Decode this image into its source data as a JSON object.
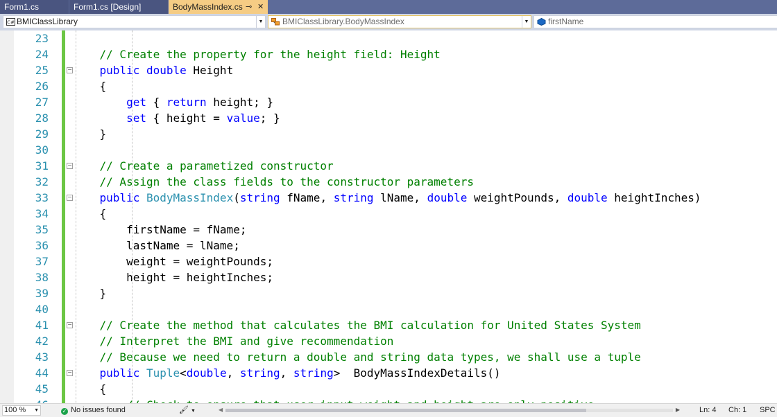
{
  "tabs": [
    {
      "label": "Form1.cs"
    },
    {
      "label": "Form1.cs [Design]"
    },
    {
      "label": "BodyMassIndex.cs",
      "pin": "⊸",
      "close": "✕"
    }
  ],
  "nav": {
    "project": "BMIClassLibrary",
    "type": "BMIClassLibrary.BodyMassIndex",
    "member": "firstName"
  },
  "lines": [
    {
      "n": "23",
      "parts": []
    },
    {
      "n": "24",
      "parts": [
        {
          "t": "c",
          "v": "    // Create the property for the height field: Height"
        }
      ]
    },
    {
      "n": "25",
      "fold": true,
      "parts": [
        {
          "t": "p",
          "v": "    "
        },
        {
          "t": "k",
          "v": "public"
        },
        {
          "t": "p",
          "v": " "
        },
        {
          "t": "k",
          "v": "double"
        },
        {
          "t": "p",
          "v": " Height"
        }
      ]
    },
    {
      "n": "26",
      "parts": [
        {
          "t": "p",
          "v": "    {"
        }
      ]
    },
    {
      "n": "27",
      "parts": [
        {
          "t": "p",
          "v": "        "
        },
        {
          "t": "k",
          "v": "get"
        },
        {
          "t": "p",
          "v": " { "
        },
        {
          "t": "k",
          "v": "return"
        },
        {
          "t": "p",
          "v": " height; }"
        }
      ]
    },
    {
      "n": "28",
      "parts": [
        {
          "t": "p",
          "v": "        "
        },
        {
          "t": "k",
          "v": "set"
        },
        {
          "t": "p",
          "v": " { height = "
        },
        {
          "t": "k",
          "v": "value"
        },
        {
          "t": "p",
          "v": "; }"
        }
      ]
    },
    {
      "n": "29",
      "parts": [
        {
          "t": "p",
          "v": "    }"
        }
      ]
    },
    {
      "n": "30",
      "parts": []
    },
    {
      "n": "31",
      "fold": true,
      "parts": [
        {
          "t": "c",
          "v": "    // Create a parametized constructor"
        }
      ]
    },
    {
      "n": "32",
      "parts": [
        {
          "t": "c",
          "v": "    // Assign the class fields to the constructor parameters"
        }
      ]
    },
    {
      "n": "33",
      "fold": true,
      "parts": [
        {
          "t": "p",
          "v": "    "
        },
        {
          "t": "k",
          "v": "public"
        },
        {
          "t": "p",
          "v": " "
        },
        {
          "t": "y",
          "v": "BodyMassIndex"
        },
        {
          "t": "p",
          "v": "("
        },
        {
          "t": "k",
          "v": "string"
        },
        {
          "t": "p",
          "v": " fName, "
        },
        {
          "t": "k",
          "v": "string"
        },
        {
          "t": "p",
          "v": " lName, "
        },
        {
          "t": "k",
          "v": "double"
        },
        {
          "t": "p",
          "v": " weightPounds, "
        },
        {
          "t": "k",
          "v": "double"
        },
        {
          "t": "p",
          "v": " heightInches)"
        }
      ]
    },
    {
      "n": "34",
      "parts": [
        {
          "t": "p",
          "v": "    {"
        }
      ]
    },
    {
      "n": "35",
      "parts": [
        {
          "t": "p",
          "v": "        firstName = fName;"
        }
      ]
    },
    {
      "n": "36",
      "parts": [
        {
          "t": "p",
          "v": "        lastName = lName;"
        }
      ]
    },
    {
      "n": "37",
      "parts": [
        {
          "t": "p",
          "v": "        weight = weightPounds;"
        }
      ]
    },
    {
      "n": "38",
      "parts": [
        {
          "t": "p",
          "v": "        height = heightInches;"
        }
      ]
    },
    {
      "n": "39",
      "parts": [
        {
          "t": "p",
          "v": "    }"
        }
      ]
    },
    {
      "n": "40",
      "parts": []
    },
    {
      "n": "41",
      "fold": true,
      "parts": [
        {
          "t": "c",
          "v": "    // Create the method that calculates the BMI calculation for United States System"
        }
      ]
    },
    {
      "n": "42",
      "parts": [
        {
          "t": "c",
          "v": "    // Interpret the BMI and give recommendation"
        }
      ]
    },
    {
      "n": "43",
      "parts": [
        {
          "t": "c",
          "v": "    // Because we need to return a double and string data types, we shall use a tuple"
        }
      ]
    },
    {
      "n": "44",
      "fold": true,
      "parts": [
        {
          "t": "p",
          "v": "    "
        },
        {
          "t": "k",
          "v": "public"
        },
        {
          "t": "p",
          "v": " "
        },
        {
          "t": "y",
          "v": "Tuple"
        },
        {
          "t": "p",
          "v": "<"
        },
        {
          "t": "k",
          "v": "double"
        },
        {
          "t": "p",
          "v": ", "
        },
        {
          "t": "k",
          "v": "string"
        },
        {
          "t": "p",
          "v": ", "
        },
        {
          "t": "k",
          "v": "string"
        },
        {
          "t": "p",
          "v": ">  BodyMassIndexDetails()"
        }
      ]
    },
    {
      "n": "45",
      "parts": [
        {
          "t": "p",
          "v": "    {"
        }
      ]
    },
    {
      "n": "46",
      "parts": [
        {
          "t": "c",
          "v": "        // Check to ensure that user input weight and height are only positive"
        }
      ]
    }
  ],
  "status": {
    "zoom": "100 %",
    "issues": "No issues found",
    "ln": "Ln: 4",
    "ch": "Ch: 1",
    "mode": "SPC"
  },
  "colors": {
    "tab_bar": "#5d6b99",
    "active_tab": "#f5cc84",
    "comment": "#008000",
    "keyword": "#0000ff",
    "type": "#2b91af",
    "line_number": "#2b91af",
    "change_bar": "#6cc644"
  }
}
